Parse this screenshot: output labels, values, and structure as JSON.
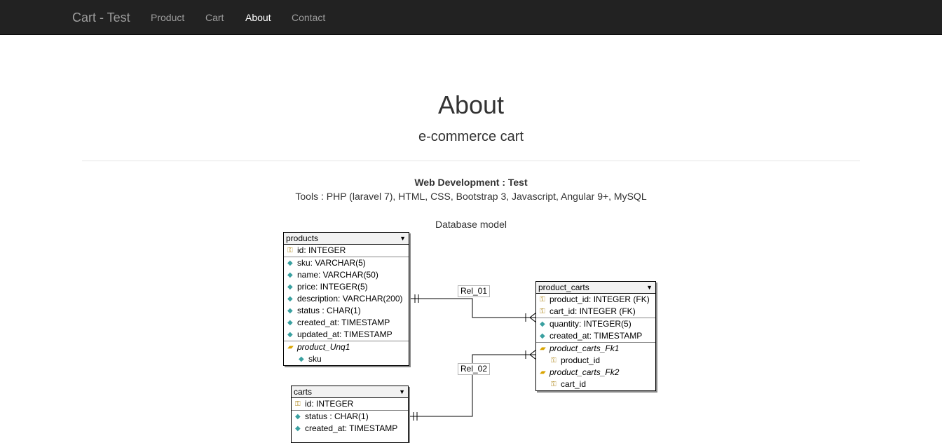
{
  "nav": {
    "brand": "Cart - Test",
    "links": [
      {
        "label": "Product",
        "active": false
      },
      {
        "label": "Cart",
        "active": false
      },
      {
        "label": "About",
        "active": true
      },
      {
        "label": "Contact",
        "active": false
      }
    ]
  },
  "page": {
    "title": "About",
    "subtitle": "e-commerce cart",
    "credit": "Web Development : Test",
    "tools": "Tools : PHP (laravel 7), HTML, CSS, Bootstrap 3, Javascript, Angular 9+, MySQL",
    "diagram_caption": "Database model"
  },
  "diagram": {
    "products": {
      "name": "products",
      "fields": [
        "id: INTEGER",
        "sku: VARCHAR(5)",
        "name: VARCHAR(50)",
        "price: INTEGER(5)",
        "description: VARCHAR(200)",
        "status  : CHAR(1)",
        "created_at: TIMESTAMP",
        "updated_at: TIMESTAMP"
      ],
      "index_name": "product_Unq1",
      "index_field": "sku"
    },
    "carts": {
      "name": "carts",
      "fields": [
        "id: INTEGER",
        "status  : CHAR(1)",
        "created_at: TIMESTAMP"
      ]
    },
    "product_carts": {
      "name": "product_carts",
      "fields": [
        "product_id: INTEGER (FK)",
        "cart_id: INTEGER (FK)",
        "quantity: INTEGER(5)",
        "created_at: TIMESTAMP"
      ],
      "fk1_name": "product_carts_Fk1",
      "fk1_field": "product_id",
      "fk2_name": "product_carts_Fk2",
      "fk2_field": "cart_id"
    },
    "relations": [
      "Rel_01",
      "Rel_02"
    ]
  },
  "colors": {
    "navbar": "#222222",
    "nav_text": "#9d9d9d",
    "nav_active": "#ffffff"
  }
}
